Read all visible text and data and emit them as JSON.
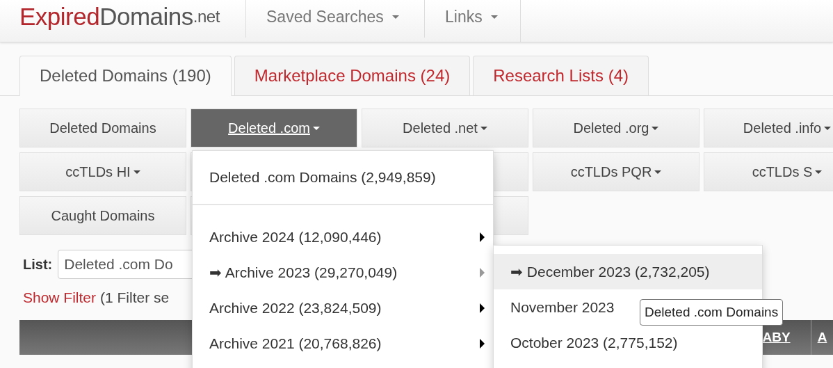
{
  "header": {
    "logo": {
      "part_1": "Expired",
      "part_2": "Domains",
      "part_3": ".net"
    },
    "nav": [
      {
        "label": "Saved Searches",
        "caret": true
      },
      {
        "label": "Links",
        "caret": true
      }
    ]
  },
  "tabs": [
    {
      "label": "Deleted Domains (190)",
      "selected": true
    },
    {
      "label": "Marketplace Domains (24)",
      "selected": false
    },
    {
      "label": "Research Lists (4)",
      "selected": false
    }
  ],
  "button_rows": [
    [
      {
        "label": "Deleted Domains",
        "caret": false,
        "selected": false
      },
      {
        "label": "Deleted .com",
        "caret": true,
        "selected": true
      },
      {
        "label": "Deleted .net",
        "caret": true,
        "selected": false
      },
      {
        "label": "Deleted .org",
        "caret": true,
        "selected": false
      },
      {
        "label": "Deleted .info",
        "caret": true,
        "selected": false
      }
    ],
    [
      {
        "label": "ccTLDs HI",
        "caret": true,
        "selected": false
      },
      null,
      null,
      {
        "label": "ccTLDs PQR",
        "caret": true,
        "selected": false
      },
      {
        "label": "ccTLDs S",
        "caret": true,
        "selected": false
      }
    ],
    [
      {
        "label": "Caught Domains",
        "caret": false,
        "selected": false
      },
      null,
      null
    ]
  ],
  "list": {
    "label": "List:",
    "value": "Deleted .com Do"
  },
  "filter": {
    "link": "Show Filter",
    "note": "(1 Filter se"
  },
  "table": {
    "columns": [
      "ABY",
      "A"
    ]
  },
  "dropdown": {
    "header": "Deleted .com Domains (2,949,859)",
    "items": [
      {
        "label": "Archive 2024 (12,090,446)",
        "selected": false
      },
      {
        "label": "➡ Archive 2023 (29,270,049)",
        "selected": true
      },
      {
        "label": "Archive 2022 (23,824,509)",
        "selected": false
      },
      {
        "label": "Archive 2021 (20,768,826)",
        "selected": false
      }
    ]
  },
  "submenu": {
    "items": [
      {
        "label": "➡ December 2023 (2,732,205)",
        "selected": true
      },
      {
        "label": "November 2023",
        "selected": false
      },
      {
        "label": "October 2023 (2,775,152)",
        "selected": false
      }
    ]
  },
  "tooltip": {
    "text": "Deleted .com Domains"
  }
}
